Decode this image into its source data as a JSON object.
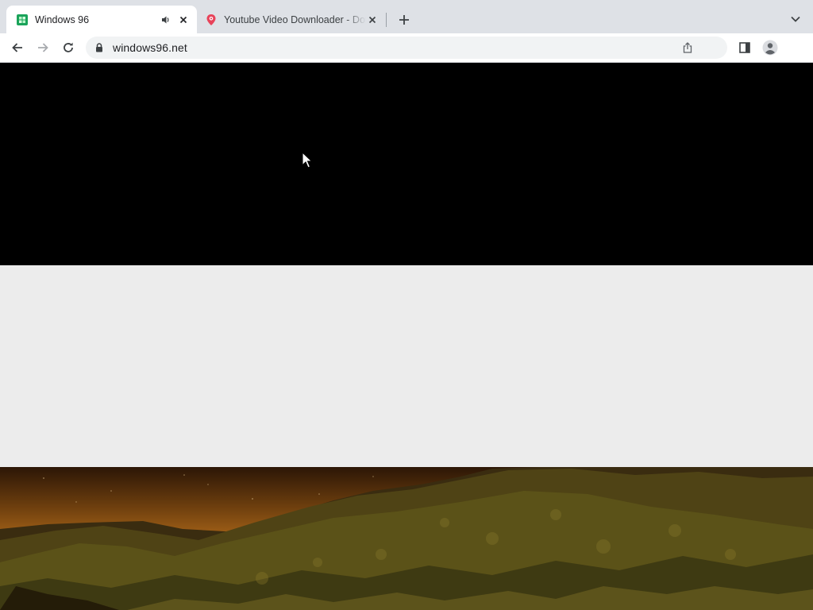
{
  "tabs": [
    {
      "title": "Windows 96",
      "active": true,
      "audio_playing": true,
      "favicon": "windows96-logo-icon"
    },
    {
      "title": "Youtube Video Downloader - Download",
      "active": false,
      "favicon": "map-pin-icon"
    }
  ],
  "toolbar": {
    "url": "windows96.net",
    "secure": true
  },
  "page": {
    "top_band_color": "#000000",
    "middle_band_color": "#ececec",
    "wallpaper": "night mountain landscape"
  },
  "colors": {
    "tabstrip_bg": "#dee1e6",
    "omnibox_bg": "#f1f3f4",
    "windows96_green": "#1aa35a",
    "pin_red": "#e8435a"
  }
}
